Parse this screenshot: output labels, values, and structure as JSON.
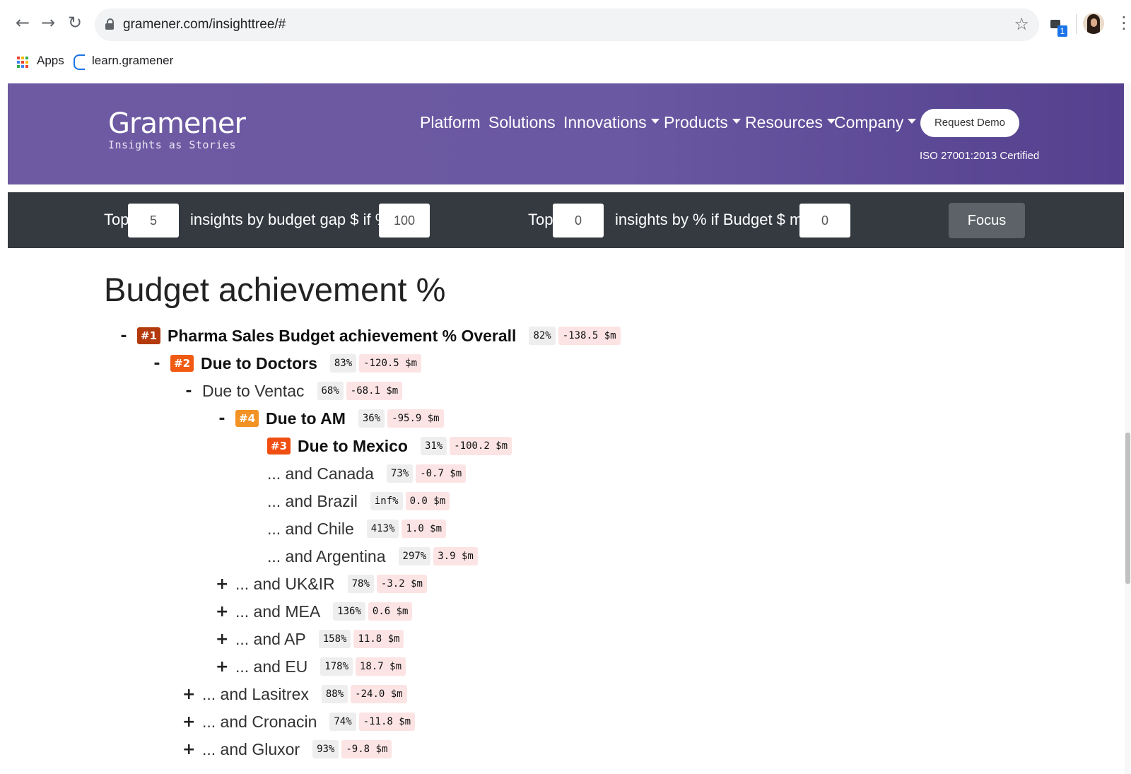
{
  "browser": {
    "url": "gramener.com/insighttree/#",
    "bookmarks": [
      {
        "label": "Apps",
        "icon": "apps-grid-icon"
      },
      {
        "label": "learn.gramener",
        "icon": "g-bookmark-icon"
      }
    ]
  },
  "header": {
    "logo": "Gramener",
    "tagline": "Insights as Stories",
    "nav": [
      {
        "label": "Platform",
        "dropdown": false
      },
      {
        "label": "Solutions",
        "dropdown": false
      },
      {
        "label": "Innovations",
        "dropdown": true
      },
      {
        "label": "Products",
        "dropdown": true
      },
      {
        "label": "Resources",
        "dropdown": true
      },
      {
        "label": "Company",
        "dropdown": true
      }
    ],
    "cta": "Request Demo",
    "certification": "ISO 27001:2013 Certified"
  },
  "filters": {
    "top_label_1": "Top",
    "top_value_1": "5",
    "text_1": "insights by budget gap $ if % <",
    "threshold_1": "100",
    "top_label_2": "Top",
    "top_value_2": "0",
    "text_2": "insights by % if Budget $ mn >",
    "threshold_2": "0",
    "focus_mode": "Focus mode"
  },
  "title": "Budget achievement %",
  "colors": {
    "rank_1": "#b23a0c",
    "rank_2": "#f05a12",
    "rank_3": "#f04e12",
    "rank_4": "#f39325"
  },
  "tree": [
    {
      "toggle": "-",
      "rank": "#1",
      "label": "Pharma Sales Budget achievement % Overall",
      "bold": true,
      "pct": "82%",
      "gap": "-138.5 $m"
    },
    {
      "toggle": "-",
      "rank": "#2",
      "label": "Due to Doctors",
      "bold": true,
      "pct": "83%",
      "gap": "-120.5 $m"
    },
    {
      "toggle": "-",
      "rank": "",
      "label": "Due to Ventac",
      "bold": false,
      "pct": "68%",
      "gap": "-68.1 $m"
    },
    {
      "toggle": "-",
      "rank": "#4",
      "label": "Due to AM",
      "bold": true,
      "pct": "36%",
      "gap": "-95.9 $m"
    },
    {
      "toggle": "",
      "rank": "#3",
      "label": "Due to Mexico",
      "bold": true,
      "pct": "31%",
      "gap": "-100.2 $m"
    },
    {
      "toggle": "",
      "rank": "",
      "label": "... and Canada",
      "bold": false,
      "pct": "73%",
      "gap": "-0.7 $m"
    },
    {
      "toggle": "",
      "rank": "",
      "label": "... and Brazil",
      "bold": false,
      "pct": "inf%",
      "gap": "0.0 $m"
    },
    {
      "toggle": "",
      "rank": "",
      "label": "... and Chile",
      "bold": false,
      "pct": "413%",
      "gap": "1.0 $m"
    },
    {
      "toggle": "",
      "rank": "",
      "label": "... and Argentina",
      "bold": false,
      "pct": "297%",
      "gap": "3.9 $m"
    },
    {
      "toggle": "+",
      "rank": "",
      "label": "... and UK&IR",
      "bold": false,
      "pct": "78%",
      "gap": "-3.2 $m"
    },
    {
      "toggle": "+",
      "rank": "",
      "label": "... and MEA",
      "bold": false,
      "pct": "136%",
      "gap": "0.6 $m"
    },
    {
      "toggle": "+",
      "rank": "",
      "label": "... and AP",
      "bold": false,
      "pct": "158%",
      "gap": "11.8 $m"
    },
    {
      "toggle": "+",
      "rank": "",
      "label": "... and EU",
      "bold": false,
      "pct": "178%",
      "gap": "18.7 $m"
    },
    {
      "toggle": "+",
      "rank": "",
      "label": "... and Lasitrex",
      "bold": false,
      "pct": "88%",
      "gap": "-24.0 $m"
    },
    {
      "toggle": "+",
      "rank": "",
      "label": "... and Cronacin",
      "bold": false,
      "pct": "74%",
      "gap": "-11.8 $m"
    },
    {
      "toggle": "+",
      "rank": "",
      "label": "... and Gluxor",
      "bold": false,
      "pct": "93%",
      "gap": "-9.8 $m"
    }
  ]
}
